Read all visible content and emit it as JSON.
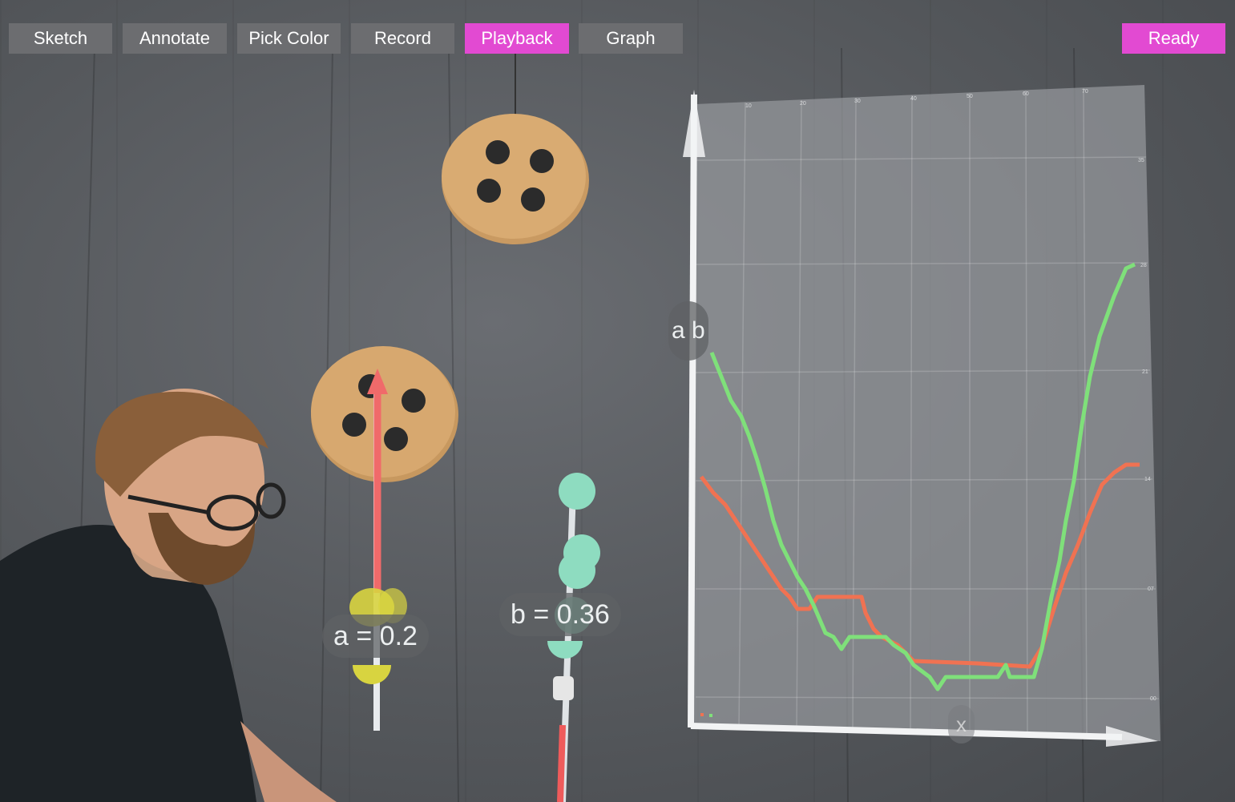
{
  "toolbar": {
    "buttons": [
      {
        "label": "Sketch",
        "active": false
      },
      {
        "label": "Annotate",
        "active": false
      },
      {
        "label": "Pick Color",
        "active": false
      },
      {
        "label": "Record",
        "active": false
      },
      {
        "label": "Playback",
        "active": true
      },
      {
        "label": "Graph",
        "active": false
      }
    ],
    "status_label": "Ready"
  },
  "colors": {
    "button_bg": "#6c6d70",
    "button_active": "#e24ad2",
    "series_a": "#f07252",
    "series_b": "#7fe07a"
  },
  "annotations": {
    "a_label": "a = 0.2",
    "b_label": "b = 0.36"
  },
  "graph": {
    "legend_label": "a b",
    "x_axis_label": "x",
    "x_ticks": [
      "10",
      "20",
      "30",
      "40",
      "50",
      "60",
      "70"
    ],
    "y_ticks": [
      "35",
      "28",
      "21",
      "14",
      "07",
      "00"
    ]
  }
}
